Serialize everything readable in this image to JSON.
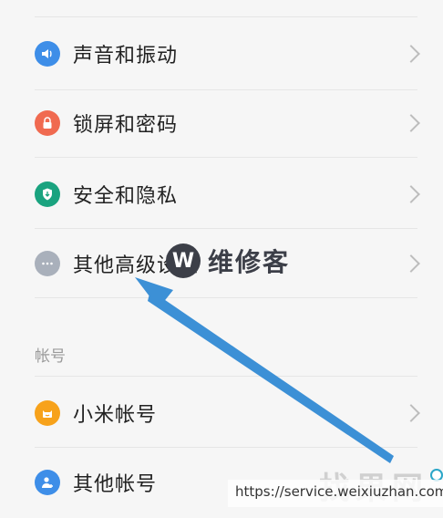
{
  "settings": {
    "items": [
      {
        "label": "声音和振动",
        "icon": "speaker-icon",
        "color": "#3e8ee8"
      },
      {
        "label": "锁屏和密码",
        "icon": "lock-icon",
        "color": "#f06a50"
      },
      {
        "label": "安全和隐私",
        "icon": "shield-icon",
        "color": "#1aa37f"
      },
      {
        "label": "其他高级设置",
        "icon": "more-icon",
        "color": "#a9b0bb"
      }
    ],
    "section_title": "帐号",
    "account_items": [
      {
        "label": "小米帐号",
        "icon": "mi-account-icon",
        "color": "#f7a21b"
      },
      {
        "label": "其他帐号",
        "icon": "user-plus-icon",
        "color": "#3e8ee8"
      }
    ]
  },
  "overlay": {
    "watermark_logo": "W",
    "watermark_text": "维修客",
    "url": "https://service.weixiuzhan.com",
    "brand": "找果网",
    "arrow_color": "#3c90d6"
  }
}
